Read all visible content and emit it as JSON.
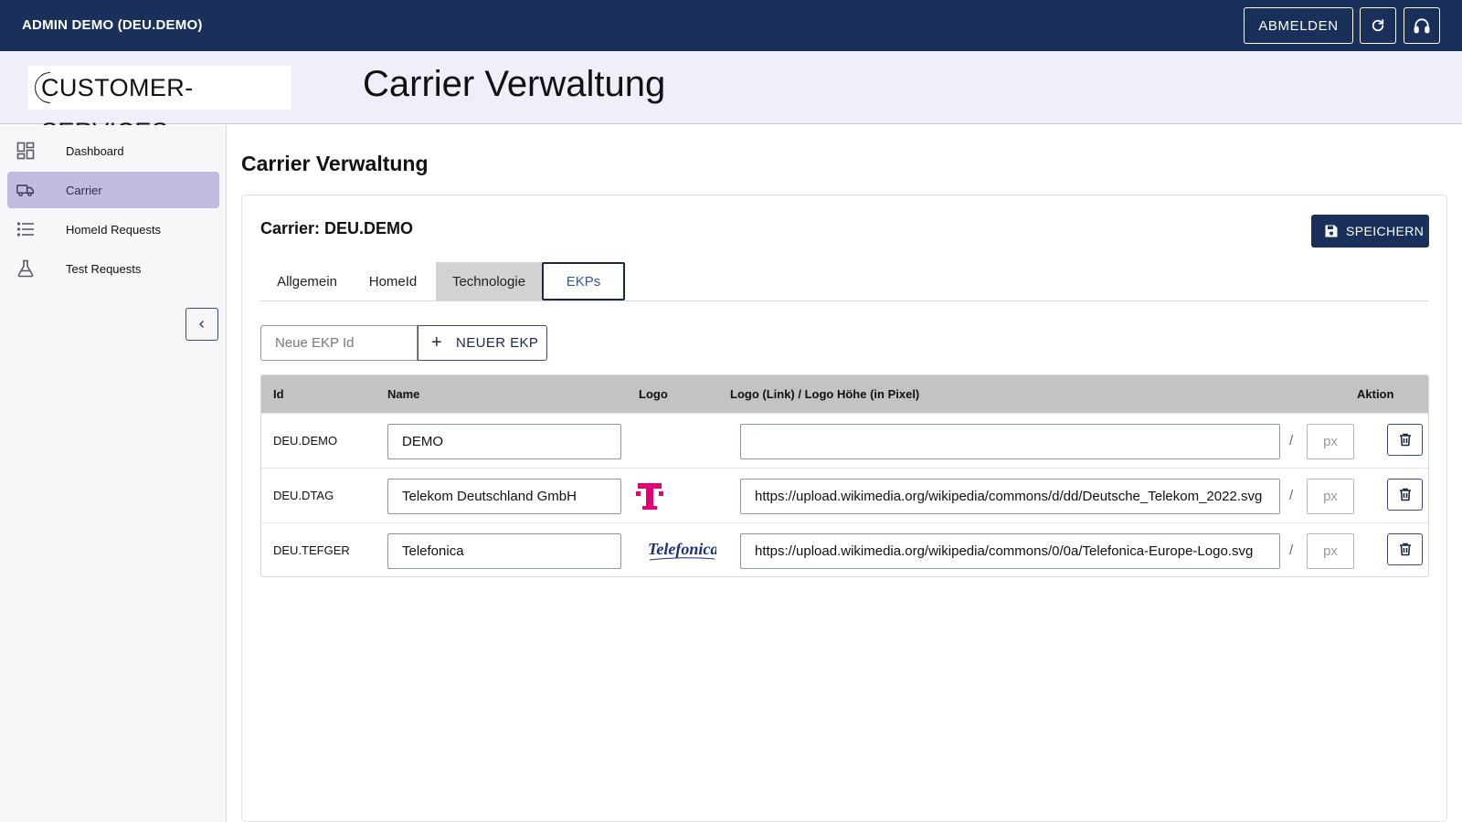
{
  "topbar": {
    "user_label": "ADMIN DEMO (DEU.DEMO)",
    "logout_label": "ABMELDEN",
    "refresh_icon": "refresh-icon",
    "support_icon": "headset-icon"
  },
  "header": {
    "logo_text": "CUSTOMER-SERVICES",
    "title": "Carrier Verwaltung"
  },
  "sidebar": {
    "items": [
      {
        "label": "Dashboard",
        "icon": "dashboard-icon",
        "active": false
      },
      {
        "label": "Carrier",
        "icon": "truck-icon",
        "active": true
      },
      {
        "label": "HomeId Requests",
        "icon": "list-icon",
        "active": false
      },
      {
        "label": "Test Requests",
        "icon": "flask-icon",
        "active": false
      }
    ],
    "collapse_icon": "chevron-left-icon"
  },
  "main": {
    "title": "Carrier Verwaltung",
    "carrier_title": "Carrier: DEU.DEMO",
    "save_label": "SPEICHERN",
    "tabs": [
      {
        "label": "Allgemein"
      },
      {
        "label": "HomeId"
      },
      {
        "label": "Technologie"
      },
      {
        "label": "EKPs",
        "active": true
      }
    ],
    "new_ekp": {
      "placeholder": "Neue EKP Id",
      "button_label": "NEUER EKP"
    },
    "table": {
      "headers": {
        "id": "Id",
        "name": "Name",
        "logo": "Logo",
        "link": "Logo (Link) / Logo Höhe (in Pixel)",
        "action": "Aktion"
      },
      "px_placeholder": "px",
      "rows": [
        {
          "id": "DEU.DEMO",
          "name": "DEMO",
          "logo": "",
          "link": ""
        },
        {
          "id": "DEU.DTAG",
          "name": "Telekom Deutschland GmbH",
          "logo": "telekom-t-logo",
          "link": "https://upload.wikimedia.org/wikipedia/commons/d/dd/Deutsche_Telekom_2022.svg"
        },
        {
          "id": "DEU.TEFGER",
          "name": "Telefonica",
          "logo": "Telefonica",
          "link": "https://upload.wikimedia.org/wikipedia/commons/0/0a/Telefonica-Europe-Logo.svg"
        }
      ]
    }
  },
  "colors": {
    "primary": "#18305a",
    "active_nav": "#c2bce0",
    "telekom_magenta": "#e20074",
    "telefonica_blue": "#1b2f7a"
  }
}
